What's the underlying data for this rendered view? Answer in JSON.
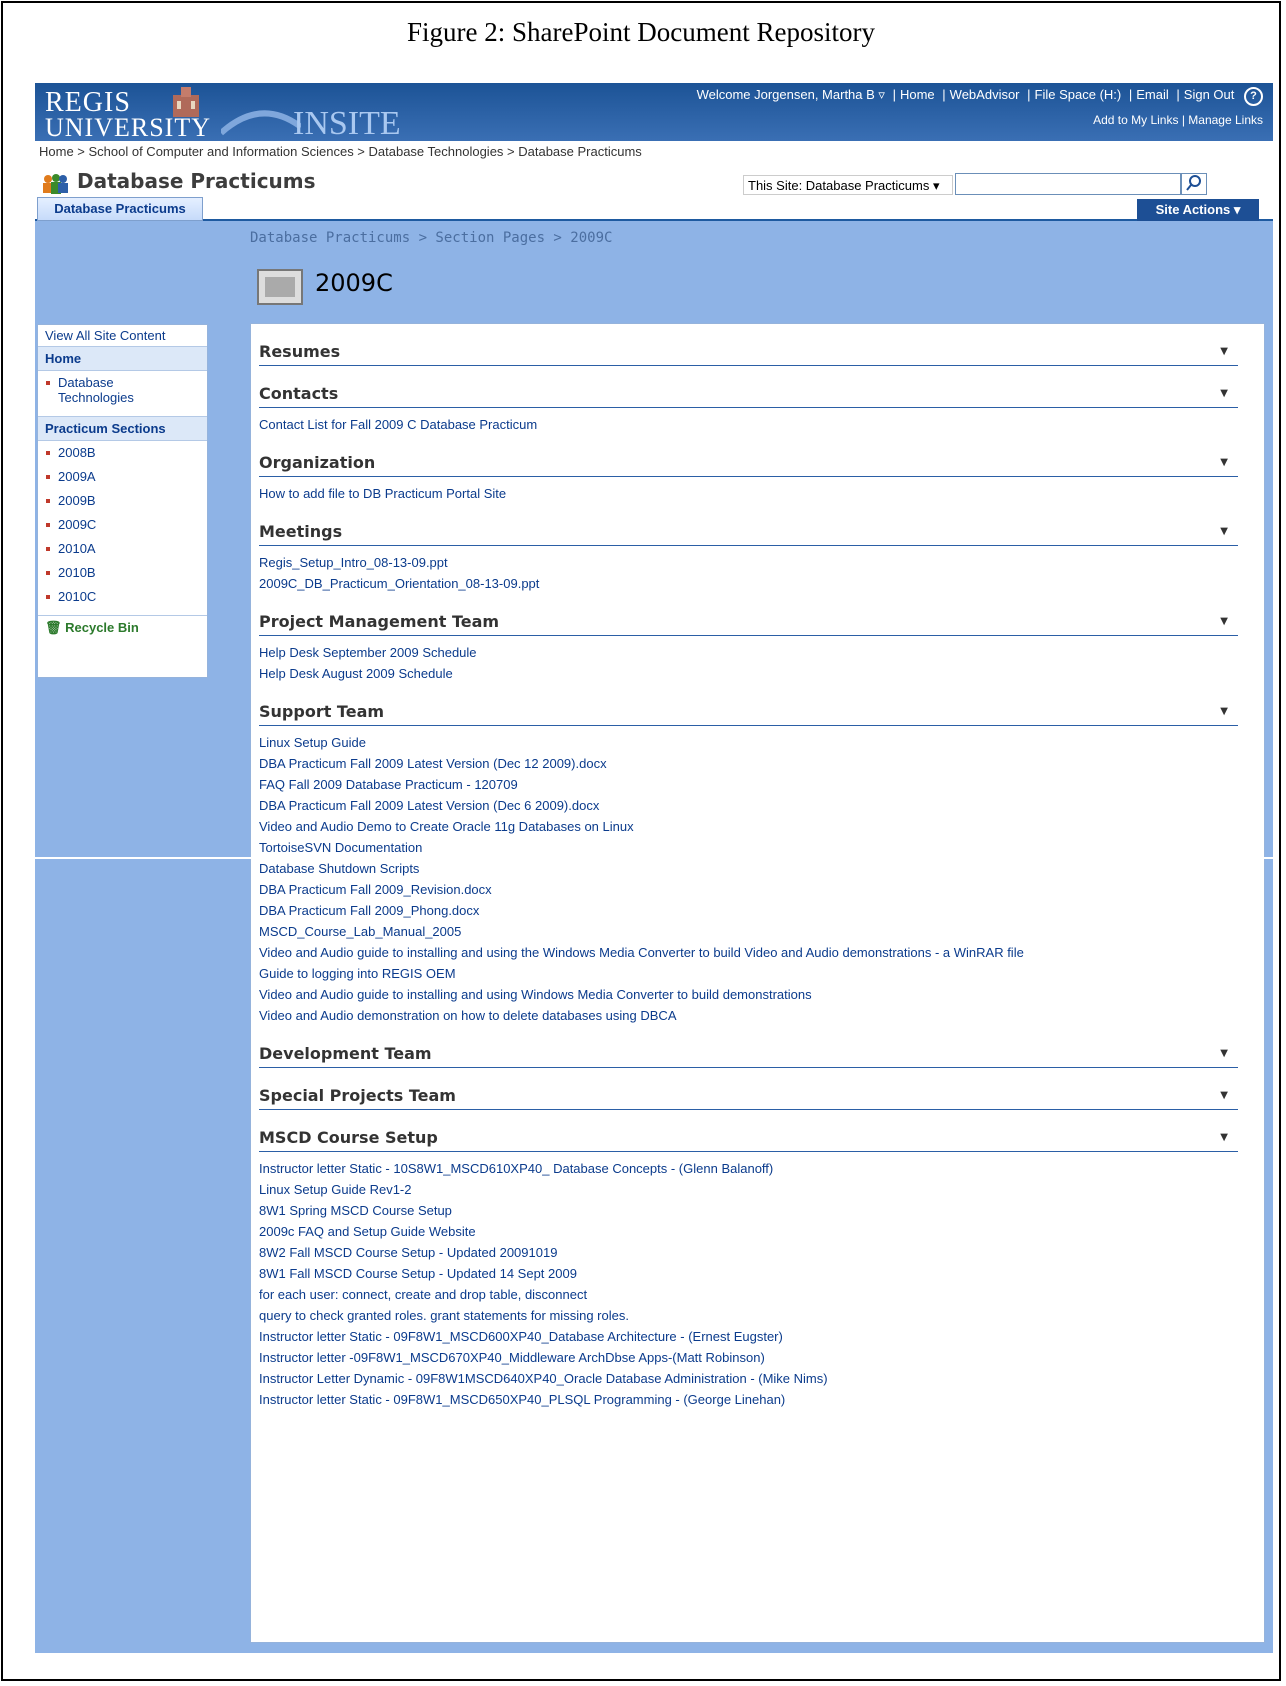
{
  "figure_caption": "Figure 2: SharePoint Document Repository",
  "brand": {
    "regis": "REGIS",
    "university": "UNIVERSITY",
    "insite": "INSITE"
  },
  "utility": {
    "welcome": "Welcome Jorgensen, Martha B",
    "links": [
      "Home",
      "WebAdvisor",
      "File Space (H:)",
      "Email",
      "Sign Out"
    ],
    "help": "?",
    "add_links": "Add to My Links",
    "manage_links": "Manage Links"
  },
  "top_breadcrumb": "Home > School of Computer and Information Sciences > Database Technologies > Database Practicums",
  "site_title": "Database Practicums",
  "search": {
    "scope": "This Site: Database Practicums",
    "value": ""
  },
  "tab_label": "Database Practicums",
  "site_actions": "Site Actions",
  "page_breadcrumb": "Database Practicums > Section Pages > 2009C",
  "page_title": "2009C",
  "leftnav": {
    "view_all": "View All Site Content",
    "home": "Home",
    "home_items": [
      "Database Technologies"
    ],
    "sections_heading": "Practicum Sections",
    "sections": [
      "2008B",
      "2009A",
      "2009B",
      "2009C",
      "2010A",
      "2010B",
      "2010C"
    ],
    "recycle": "Recycle Bin"
  },
  "sections": [
    {
      "title": "Resumes",
      "items": []
    },
    {
      "title": "Contacts",
      "items": [
        "Contact List for Fall 2009 C Database Practicum"
      ]
    },
    {
      "title": "Organization",
      "items": [
        "How to add file to DB Practicum Portal Site"
      ]
    },
    {
      "title": "Meetings",
      "items": [
        "Regis_Setup_Intro_08-13-09.ppt",
        "2009C_DB_Practicum_Orientation_08-13-09.ppt"
      ]
    },
    {
      "title": "Project Management Team",
      "items": [
        "Help Desk September 2009 Schedule",
        "Help Desk August 2009 Schedule"
      ]
    },
    {
      "title": "Support Team",
      "items": [
        "Linux Setup Guide",
        "DBA Practicum Fall 2009 Latest Version (Dec 12 2009).docx",
        "FAQ Fall 2009 Database Practicum - 120709",
        "DBA Practicum Fall 2009 Latest Version (Dec 6 2009).docx",
        "Video and Audio Demo to Create Oracle 11g Databases on Linux",
        "TortoiseSVN Documentation",
        "Database Shutdown Scripts",
        "DBA Practicum Fall 2009_Revision.docx",
        "DBA Practicum Fall 2009_Phong.docx",
        "MSCD_Course_Lab_Manual_2005",
        "Video and Audio guide to installing and using the Windows Media Converter to build Video and Audio demonstrations - a WinRAR file",
        "Guide to logging into REGIS OEM",
        "Video and Audio guide to installing and using Windows Media Converter to build demonstrations",
        "Video and Audio demonstration on how to delete databases using DBCA"
      ]
    },
    {
      "title": "Development Team",
      "items": []
    },
    {
      "title": "Special Projects Team",
      "items": []
    },
    {
      "title": "MSCD Course Setup",
      "items": [
        "Instructor letter Static - 10S8W1_MSCD610XP40_ Database Concepts - (Glenn Balanoff)",
        "Linux Setup Guide Rev1-2",
        "8W1 Spring MSCD Course Setup",
        "2009c FAQ and Setup Guide Website",
        "8W2 Fall MSCD Course Setup - Updated 20091019",
        "8W1 Fall MSCD Course Setup - Updated 14 Sept 2009",
        "for each user: connect, create and drop table, disconnect",
        "query to check granted roles. grant statements for missing roles.",
        "Instructor letter Static - 09F8W1_MSCD600XP40_Database Architecture - (Ernest Eugster)",
        "Instructor letter -09F8W1_MSCD670XP40_Middleware ArchDbse Apps-(Matt Robinson)",
        "Instructor Letter Dynamic - 09F8W1MSCD640XP40_Oracle Database Administration - (Mike Nims)",
        "Instructor letter Static - 09F8W1_MSCD650XP40_PLSQL Programming - (George Linehan)"
      ]
    }
  ]
}
